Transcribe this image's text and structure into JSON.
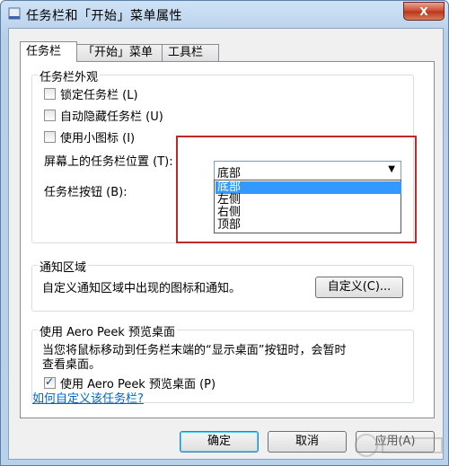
{
  "window": {
    "title": "任务栏和「开始」菜单属性",
    "close_label": "X"
  },
  "tabs": [
    {
      "label": "任务栏",
      "active": true
    },
    {
      "label": "「开始」菜单",
      "active": false
    },
    {
      "label": "工具栏",
      "active": false
    }
  ],
  "appearance": {
    "group_label": "任务栏外观",
    "checkboxes": [
      {
        "label": "锁定任务栏 (L)",
        "checked": false
      },
      {
        "label": "自动隐藏任务栏 (U)",
        "checked": false
      },
      {
        "label": "使用小图标 (I)",
        "checked": false
      }
    ],
    "position_label": "屏幕上的任务栏位置 (T):",
    "position_value": "底部",
    "position_options": [
      "底部",
      "左侧",
      "右侧",
      "顶部"
    ],
    "buttons_label": "任务栏按钮 (B):"
  },
  "notification": {
    "group_label": "通知区域",
    "description": "自定义通知区域中出现的图标和通知。",
    "customize_button": "自定义(C)..."
  },
  "aero_peek": {
    "group_label": "使用 Aero Peek 预览桌面",
    "description_line1": "当您将鼠标移动到任务栏末端的“显示桌面”按钮时，会暂时",
    "description_line2": "查看桌面。",
    "checkbox_label": "使用 Aero Peek 预览桌面 (P)",
    "checkbox_checked": true
  },
  "help_link": "如何自定义该任务栏?",
  "footer": {
    "ok": "确定",
    "cancel": "取消",
    "apply": "应用(A)"
  },
  "colors": {
    "highlight": "#3399ff",
    "annotation_box": "#c0282a",
    "link": "#0066cc"
  }
}
